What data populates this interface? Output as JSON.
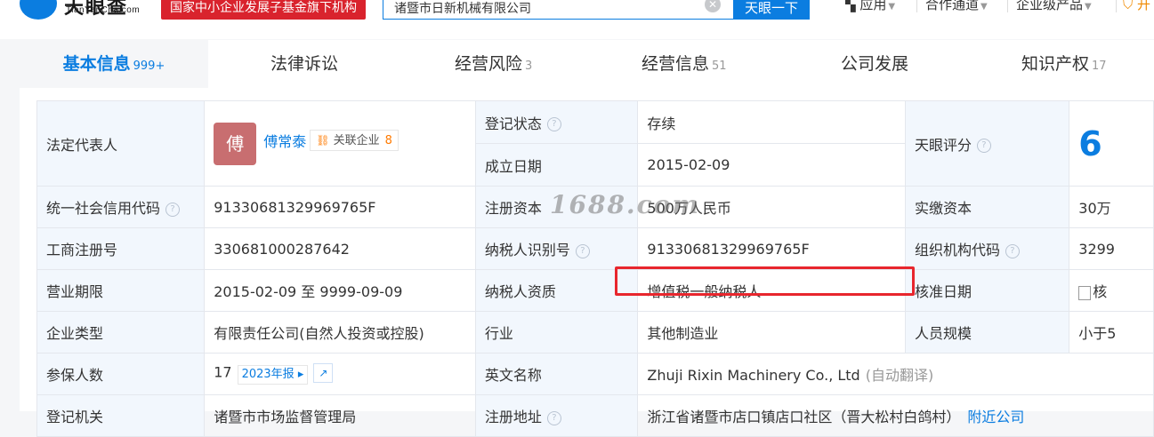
{
  "header": {
    "logo_text": "天眼查",
    "logo_sub": "TianYanCha.com",
    "banner": "国家中小企业发展子基金旗下机构",
    "search_value": "诸暨市日新机械有限公司",
    "search_button": "天眼一下",
    "nav": [
      "应用",
      "合作通道",
      "企业级产品",
      "开"
    ]
  },
  "tabs": [
    {
      "label": "基本信息",
      "count": "999+"
    },
    {
      "label": "法律诉讼",
      "count": ""
    },
    {
      "label": "经营风险",
      "count": "3"
    },
    {
      "label": "经营信息",
      "count": "51"
    },
    {
      "label": "公司发展",
      "count": ""
    },
    {
      "label": "知识产权",
      "count": "17"
    }
  ],
  "info": {
    "legal_rep_label": "法定代表人",
    "legal_rep_avatar": "傅",
    "legal_rep_name": "傅常泰",
    "assoc_label": "关联企业",
    "assoc_count": "8",
    "reg_status_label": "登记状态",
    "reg_status_value": "存续",
    "found_date_label": "成立日期",
    "found_date_value": "2015-02-09",
    "tianyan_score_label": "天眼评分",
    "tianyan_score_value": "6",
    "credit_code_label": "统一社会信用代码",
    "credit_code_value": "91330681329969765F",
    "reg_capital_label": "注册资本",
    "reg_capital_value": "500万人民币",
    "paid_capital_label": "实缴资本",
    "paid_capital_value": "30万",
    "biz_reg_no_label": "工商注册号",
    "biz_reg_no_value": "330681000287642",
    "taxpayer_id_label": "纳税人识别号",
    "taxpayer_id_value": "91330681329969765F",
    "org_code_label": "组织机构代码",
    "org_code_value": "3299",
    "biz_term_label": "营业期限",
    "biz_term_value": "2015-02-09 至 9999-09-09",
    "taxpayer_qual_label": "纳税人资质",
    "taxpayer_qual_value": "增值税一般纳税人",
    "approve_date_label": "核准日期",
    "approve_date_value": "核",
    "company_type_label": "企业类型",
    "company_type_value": "有限责任公司(自然人投资或控股)",
    "industry_label": "行业",
    "industry_value": "其他制造业",
    "staff_size_label": "人员规模",
    "staff_size_value": "小于5",
    "insured_label": "参保人数",
    "insured_value": "17",
    "insured_year": "2023年报",
    "english_name_label": "英文名称",
    "english_name_value": "Zhuji Rixin Machinery Co., Ltd",
    "english_name_note": "(自动翻译)",
    "reg_authority_label": "登记机关",
    "reg_authority_value": "诸暨市市场监督管理局",
    "reg_address_label": "注册地址",
    "reg_address_value": "浙江省诸暨市店口镇店口社区（晋大松村白鸽村）",
    "nearby_link": "附近公司"
  },
  "watermark": "1688.com"
}
